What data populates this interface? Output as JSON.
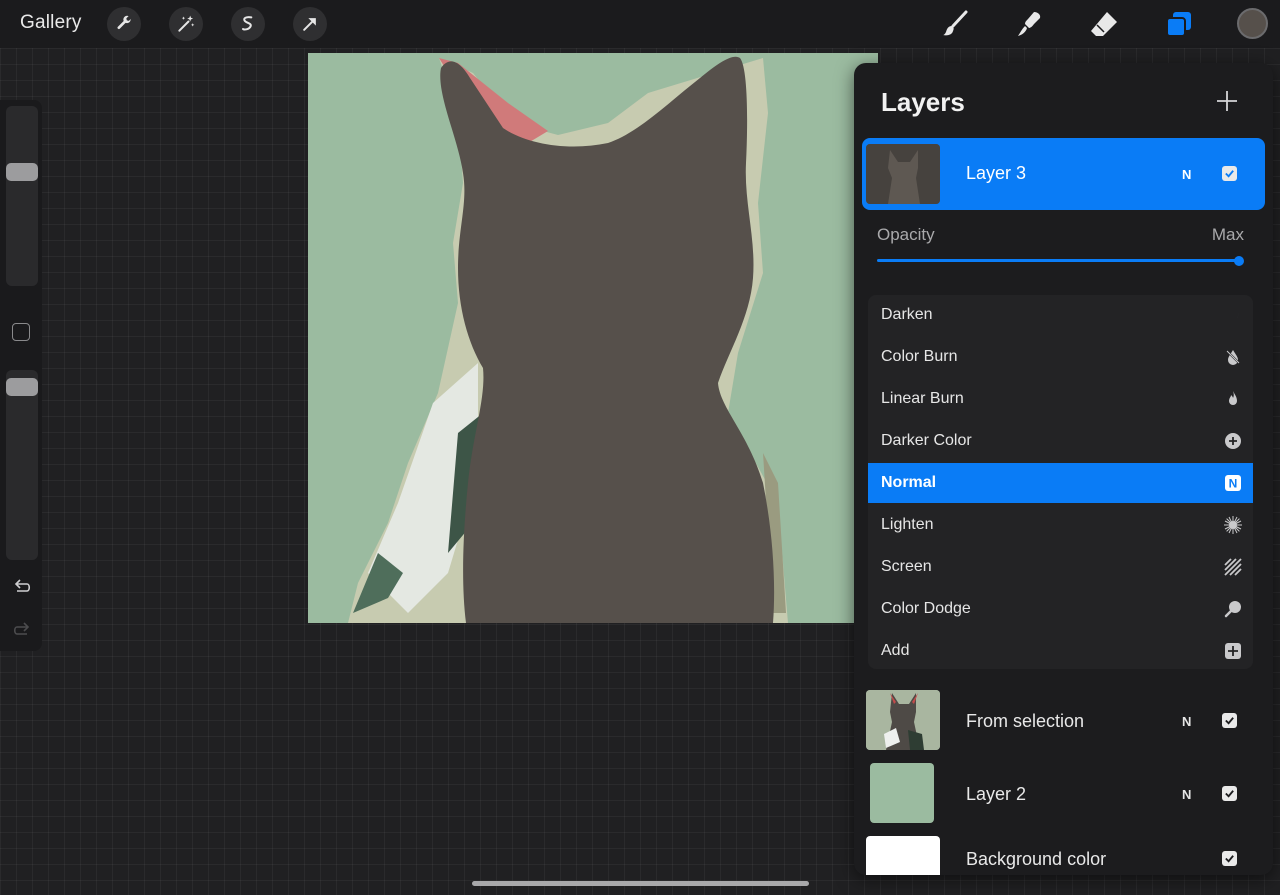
{
  "toolbar": {
    "gallery_label": "Gallery",
    "left_tools": [
      "wrench-icon",
      "magic-wand-icon",
      "selection-icon",
      "transform-arrow-icon"
    ],
    "right_tools": [
      "brush-icon",
      "smudge-icon",
      "eraser-icon",
      "layers-icon"
    ],
    "active_color": "#56504b",
    "accent_color": "#0a7cf6"
  },
  "sidebar": {
    "brush_size_level": 0.35,
    "brush_opacity_level": 0.95
  },
  "layers_panel": {
    "title": "Layers",
    "active_layer": {
      "name": "Layer 3",
      "mode": "N",
      "visible": true
    },
    "opacity": {
      "label": "Opacity",
      "value": "Max",
      "level": 1.0
    },
    "blend_modes": [
      {
        "label": "Darken",
        "icon": "moon-icon"
      },
      {
        "label": "Color Burn",
        "icon": "burn-drop-icon"
      },
      {
        "label": "Linear Burn",
        "icon": "flame-icon"
      },
      {
        "label": "Darker Color",
        "icon": "plus-circle-icon"
      },
      {
        "label": "Normal",
        "icon": "n-badge-icon",
        "badge": "N",
        "selected": true
      },
      {
        "label": "Lighten",
        "icon": "sun-burst-icon"
      },
      {
        "label": "Screen",
        "icon": "screen-hatch-icon"
      },
      {
        "label": "Color Dodge",
        "icon": "dodge-icon"
      },
      {
        "label": "Add",
        "icon": "plus-square-icon"
      }
    ],
    "layers": [
      {
        "name": "From selection",
        "mode": "N",
        "visible": true
      },
      {
        "name": "Layer 2",
        "mode": "N",
        "visible": true
      },
      {
        "name": "Background color",
        "mode": "",
        "visible": true
      }
    ],
    "canvas_background": "#9bbba0",
    "silhouette_color": "#56504b"
  }
}
